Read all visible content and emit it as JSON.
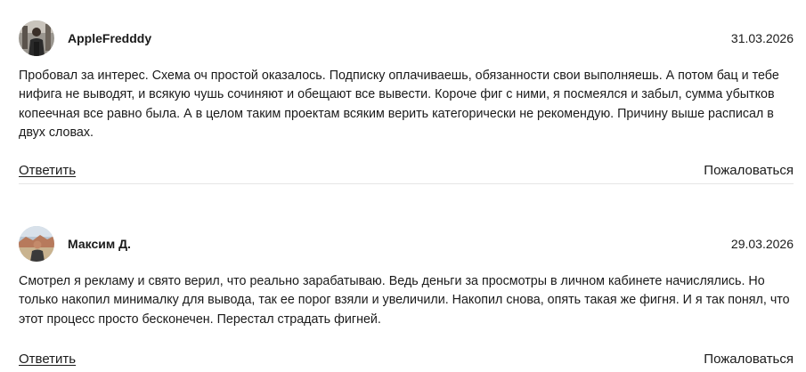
{
  "comments": [
    {
      "author": "AppleFredddy",
      "date": "31.03.2026",
      "text": "Пробовал за интерес. Схема оч простой оказалось. Подписку оплачиваешь, обязанности свои выполняешь. А потом бац и тебе нифига не выводят, и всякую чушь сочиняют и обещают все вывести. Короче фиг с ними, я посмеялся и забыл, сумма убытков копеечная все равно была. А в целом таким проектам всяким верить категорически не рекомендую. Причину выше расписал в двух словах.",
      "reply_label": "Ответить",
      "report_label": "Пожаловаться"
    },
    {
      "author": "Максим Д.",
      "date": "29.03.2026",
      "text": "Смотрел я рекламу и свято верил, что реально зарабатываю. Ведь деньги за просмотры в личном кабинете начислялись. Но только накопил минималку для вывода, так ее порог взяли и увеличили. Накопил снова, опять такая же фигня. И я так понял, что этот процесс просто бесконечен. Перестал страдать фигней.",
      "reply_label": "Ответить",
      "report_label": "Пожаловаться"
    }
  ]
}
